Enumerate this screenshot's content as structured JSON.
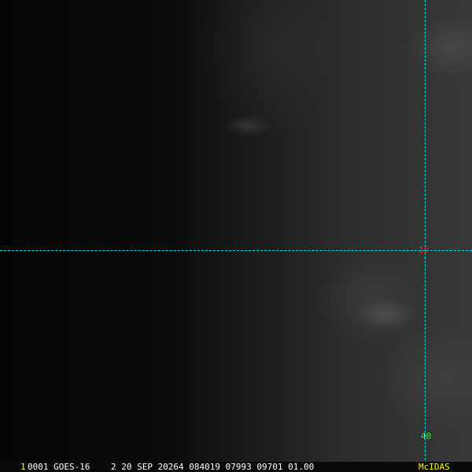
{
  "overlay": {
    "lat_label": "15",
    "lon_label": "40"
  },
  "status_bar": {
    "frame_number": "1",
    "info": "0001 GOES-16    2 20 SEP 20264 084019 07993 09701 01.00",
    "brand": "McIDAS"
  },
  "colors": {
    "grid": "#00e0e8",
    "lat_label": "#ff2020",
    "lon_label": "#20ff20",
    "frame_number": "#ffff00",
    "brand": "#ffff00"
  }
}
